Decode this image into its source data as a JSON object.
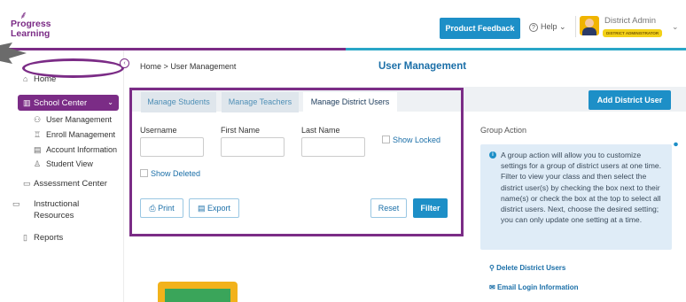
{
  "app": {
    "logo_line1": "Progress",
    "logo_line2": "Learning"
  },
  "header": {
    "product_feedback_label": "Product Feedback",
    "help_label": "Help",
    "user_name": "District Admin",
    "user_role": "DISTRICT ADMINISTRATOR"
  },
  "colors": {
    "brand_purple": "#7b2c86",
    "accent_blue": "#1d8fc7",
    "info_bg": "#dfecf7"
  },
  "sidebar": {
    "home": "Home",
    "school_center": "School Center",
    "sub_items": [
      "User Management",
      "Enroll Management",
      "Account Information",
      "Student View"
    ],
    "main_items": [
      "Assessment Center",
      "Instructional Resources",
      "Reports"
    ]
  },
  "main": {
    "breadcrumb_home": "Home",
    "breadcrumb_sep": ">",
    "breadcrumb_current": "User Management",
    "page_title": "User Management",
    "tabs": [
      {
        "label": "Manage Students",
        "active": false
      },
      {
        "label": "Manage Teachers",
        "active": false
      },
      {
        "label": "Manage District Users",
        "active": true
      }
    ],
    "add_button": "Add District User",
    "filters": {
      "username_label": "Username",
      "first_name_label": "First Name",
      "last_name_label": "Last Name",
      "show_locked_label": "Show Locked",
      "show_deleted_label": "Show Deleted"
    },
    "buttons": {
      "print": "Print",
      "export": "Export",
      "reset": "Reset",
      "filter": "Filter"
    },
    "group_action": {
      "title": "Group Action",
      "info_text": "A group action will allow you to customize settings for a group of district users at one time. Filter to view your class and then select the district user(s) by checking the box next to their name(s) or check the box at the top to select all district users. Next, choose the desired setting; you can only update one setting at a time.",
      "delete_link": "Delete District Users",
      "email_link": "Email Login Information"
    }
  }
}
